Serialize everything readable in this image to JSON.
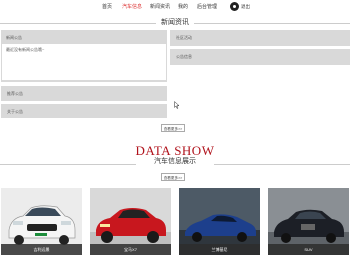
{
  "nav": {
    "items": [
      {
        "label": "首页",
        "active": false
      },
      {
        "label": "汽车信息",
        "active": true
      },
      {
        "label": "新闻资讯",
        "active": false
      },
      {
        "label": "我的",
        "active": false
      },
      {
        "label": "后台管理",
        "active": false
      }
    ],
    "user": "退出"
  },
  "news": {
    "title": "新闻资讯",
    "big_label": "新闻公告",
    "big_text": "最近没有新闻公告哦~",
    "items": [
      "社区活动",
      "公告信息",
      "推荐公告",
      "关于公告"
    ],
    "more": "查看更多>>"
  },
  "show": {
    "title": "DATA SHOW",
    "subtitle": "汽车信息展示",
    "more": "查看更多>>",
    "cars": [
      {
        "name": "吉利远景",
        "color": "#f0f0f0"
      },
      {
        "name": "宝马X7",
        "color": "#c8171e"
      },
      {
        "name": "兰博基尼",
        "color": "#1d3f8c"
      },
      {
        "name": "SUV",
        "color": "#1c1f26"
      }
    ]
  }
}
